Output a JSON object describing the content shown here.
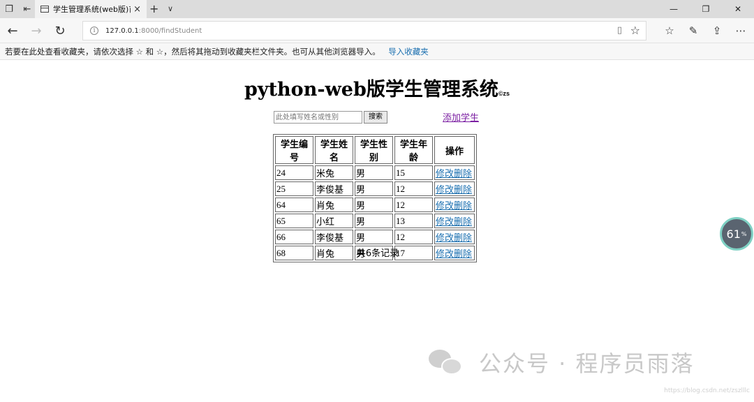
{
  "browser": {
    "tab_title": "学生管理系统(web版)首",
    "tab_close": "×",
    "new_tab": "+",
    "tab_list": "∨",
    "url_host": "127.0.0.1",
    "url_rest": ":8000/findStudent",
    "favorites_hint": "若要在此处查看收藏夹，请依次选择 ☆ 和 ☆，然后将其拖动到收藏夹栏文件夹。也可从其他浏览器导入。",
    "import_favorites": "导入收藏夹"
  },
  "page": {
    "title": "python-web版学生管理系统",
    "title_mark": "©zs",
    "search_placeholder": "此处填写姓名或性别",
    "search_button": "搜索",
    "add_student": "添加学生",
    "table": {
      "headers": [
        "学生编号",
        "学生姓名",
        "学生性别",
        "学生年龄",
        "操作"
      ],
      "rows": [
        {
          "id": "24",
          "name": "米兔",
          "sex": "男",
          "age": "15"
        },
        {
          "id": "25",
          "name": "李俊基",
          "sex": "男",
          "age": "12"
        },
        {
          "id": "64",
          "name": "肖兔",
          "sex": "男",
          "age": "12"
        },
        {
          "id": "65",
          "name": "小红",
          "sex": "男",
          "age": "13"
        },
        {
          "id": "66",
          "name": "李俊基",
          "sex": "男",
          "age": "12"
        },
        {
          "id": "68",
          "name": "肖兔",
          "sex": "男",
          "age": "17"
        }
      ],
      "edit_label": "修改",
      "delete_label": "删除"
    },
    "total": "共6条记录"
  },
  "overlay": {
    "gauge_value": "61",
    "gauge_unit": "%",
    "gauge_ring_color": "#7fd1c4",
    "watermark": "公众号 · 程序员雨落",
    "watermark_sub": "https://blog.csdn.net/zszlllc"
  },
  "colors": {
    "link": "#1a6fb0",
    "visited_link": "#7b1fa2"
  }
}
